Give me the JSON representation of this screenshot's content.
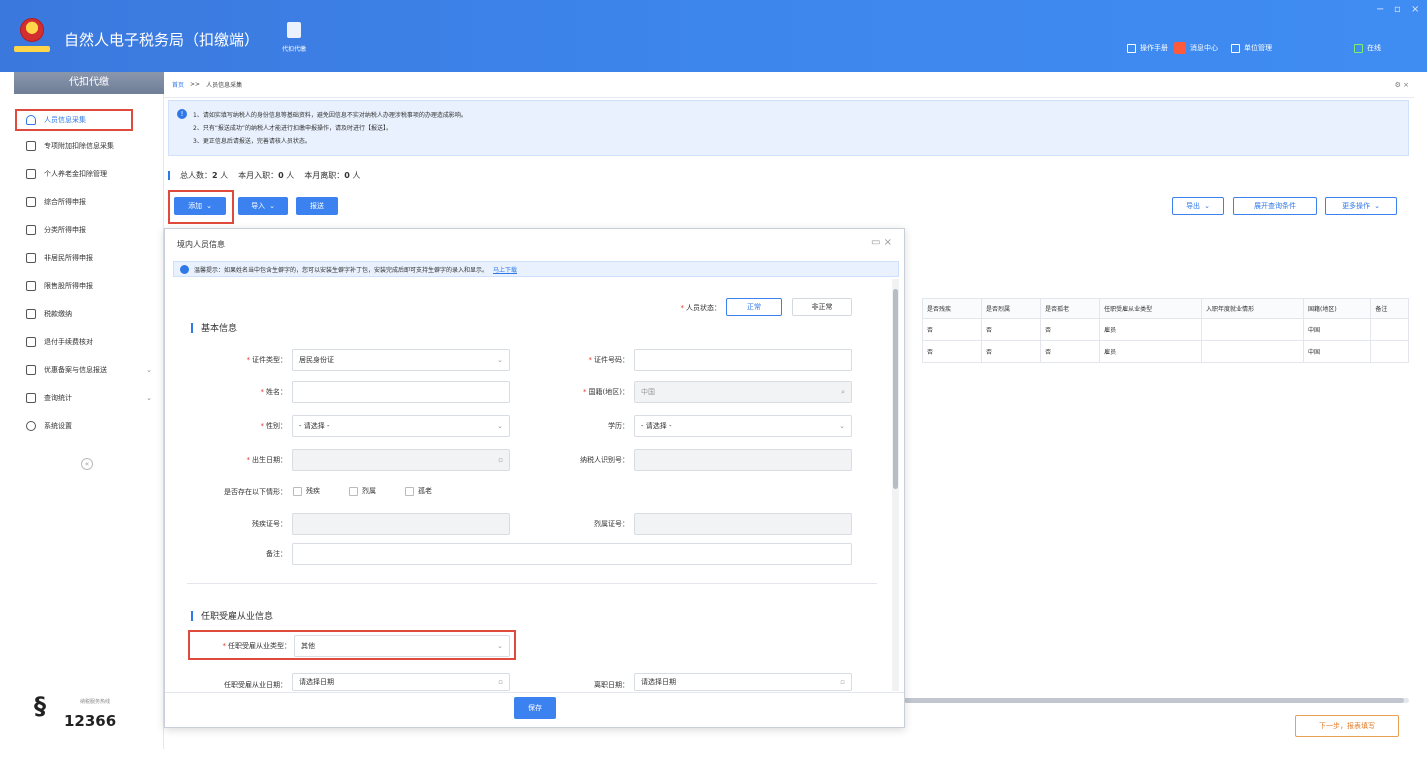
{
  "window": {
    "app_title": "自然人电子税务局（扣缴端）",
    "proxy_label": "代扣代缴",
    "top_links": [
      "操作手册",
      "消息中心",
      "单位管理",
      "在线"
    ],
    "controls": [
      "−",
      "▫",
      "×"
    ]
  },
  "sidebar": {
    "header": "代扣代缴",
    "items": [
      {
        "label": "人员信息采集"
      },
      {
        "label": "专项附加扣除信息采集"
      },
      {
        "label": "个人养老金扣除管理"
      },
      {
        "label": "综合所得申报"
      },
      {
        "label": "分类所得申报"
      },
      {
        "label": "非居民所得申报"
      },
      {
        "label": "限售股所得申报"
      },
      {
        "label": "税款缴纳"
      },
      {
        "label": "退付手续费核对"
      },
      {
        "label": "优惠备案与信息报送"
      },
      {
        "label": "查询统计"
      },
      {
        "label": "系统设置"
      }
    ],
    "collapse": "«",
    "hotline": "12366",
    "hotline_sub": "纳税服务热线"
  },
  "breadcrumb": {
    "home": "首页",
    "sep": ">>",
    "current": "人员信息采集",
    "controls": "⚙ ×"
  },
  "notice": {
    "lines": [
      "1、请如实填写纳税人的身份信息等基础资料，避免因信息不实对纳税人办理涉税事项的办理造成影响。",
      "2、只有“报送成功”的纳税人才能进行扣缴申报操作，请及时进行【报送】。",
      "3、更正信息后请报送，完善请核人员状态。"
    ]
  },
  "stats": {
    "total_label": "总人数：",
    "total": "2",
    "total_unit": "人",
    "in_label": "本月入职：",
    "in": "0",
    "in_unit": "人",
    "out_label": "本月离职：",
    "out": "0",
    "out_unit": "人"
  },
  "toolbar": {
    "add": "添加",
    "import": "导入",
    "report": "报送",
    "export": "导出",
    "expand": "展开查询条件",
    "more": "更多操作"
  },
  "table": {
    "headers": [
      "是否残疾",
      "是否烈属",
      "是否孤老",
      "任职受雇从业类型",
      "入职年度就业情形",
      "国籍(地区)",
      "备注"
    ],
    "rows": [
      [
        "否",
        "否",
        "否",
        "雇员",
        "",
        "中国",
        ""
      ],
      [
        "否",
        "否",
        "否",
        "雇员",
        "",
        "中国",
        ""
      ]
    ]
  },
  "next_button": "下一步，报表填写",
  "dialog": {
    "title": "境内人员信息",
    "tip": "温馨提示：如果姓名当中包含生僻字的，您可以安装生僻字补丁包，安装完成后即可支持生僻字的录入和显示。",
    "tip_link": "马上下载",
    "status_label": "人员状态：",
    "status_normal": "正常",
    "status_abnormal": "非正常",
    "section_basic": "基本信息",
    "id_type_label": "证件类型：",
    "id_type_value": "居民身份证",
    "id_no_label": "证件号码：",
    "name_label": "姓名：",
    "nationality_label": "国籍(地区)：",
    "nationality_value": "中国",
    "gender_label": "性别：",
    "select_placeholder": "- 请选择 -",
    "edu_label": "学历：",
    "birth_label": "出生日期：",
    "taxid_label": "纳税人识别号：",
    "situation_label": "是否存在以下情形：",
    "opt_disabled": "残疾",
    "opt_martyr": "烈属",
    "opt_elder": "孤老",
    "disabled_no_label": "残疾证号：",
    "martyr_no_label": "烈属证号：",
    "remark_label": "备注：",
    "section_employment": "任职受雇从业信息",
    "emp_type_label": "任职受雇从业类型：",
    "emp_type_value": "其他",
    "emp_date_label": "任职受雇从业日期：",
    "date_placeholder": "请选择日期",
    "leave_date_label": "离职日期：",
    "save": "保存"
  }
}
